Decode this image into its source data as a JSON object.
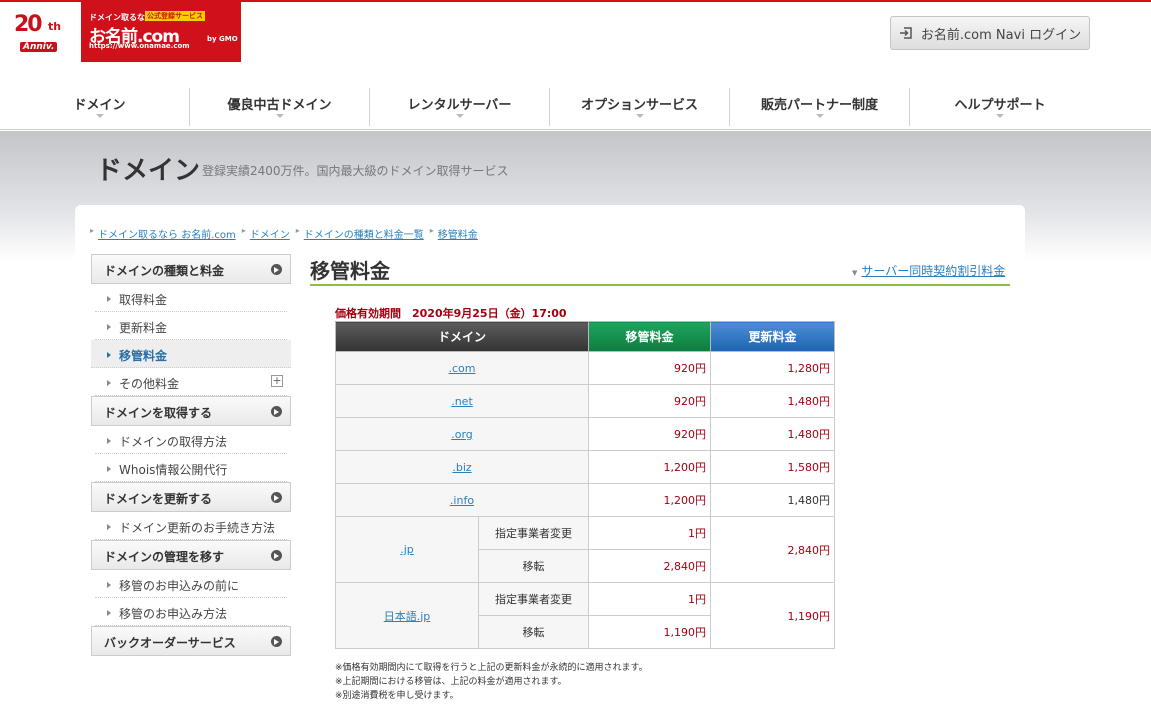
{
  "header": {
    "anniv_number": "20",
    "anniv_suffix": "th",
    "anniv_label": "Anniv.",
    "logo_tagline": "ドメイン取るなら",
    "logo_badge": "公式登録サービス",
    "logo_name": "お名前.com",
    "logo_url": "https://www.onamae.com",
    "logo_gmo": "by GMO",
    "login_label": "お名前.com Navi ログイン"
  },
  "gnav": [
    "ドメイン",
    "優良中古ドメイン",
    "レンタルサーバー",
    "オプションサービス",
    "販売パートナー制度",
    "ヘルプサポート"
  ],
  "band": {
    "title": "ドメイン",
    "desc": "登録実績2400万件。国内最大級のドメイン取得サービス"
  },
  "breadcrumb": [
    "ドメイン取るなら お名前.com",
    "ドメイン",
    "ドメインの種類と料金一覧",
    "移管料金"
  ],
  "sidebar": {
    "sections": [
      {
        "title": "ドメインの種類と料金",
        "items": [
          "取得料金",
          "更新料金",
          "移管料金",
          "その他料金"
        ]
      },
      {
        "title": "ドメインを取得する",
        "items": [
          "ドメインの取得方法",
          "Whois情報公開代行"
        ]
      },
      {
        "title": "ドメインを更新する",
        "items": [
          "ドメイン更新のお手続き方法"
        ]
      },
      {
        "title": "ドメインの管理を移す",
        "items": [
          "移管のお申込みの前に",
          "移管のお申込み方法"
        ]
      },
      {
        "title": "バックオーダーサービス",
        "items": []
      }
    ]
  },
  "main": {
    "title": "移管料金",
    "link": "サーバー同時契約割引料金",
    "period": "価格有効期間　2020年9月25日（金）17:00",
    "table": {
      "headers": [
        "ドメイン",
        "移管料金",
        "更新料金"
      ],
      "rows": [
        {
          "domain": ".com",
          "transfer": "920円",
          "renew": "1,280円"
        },
        {
          "domain": ".net",
          "transfer": "920円",
          "renew": "1,480円"
        },
        {
          "domain": ".org",
          "transfer": "920円",
          "renew": "1,480円"
        },
        {
          "domain": ".biz",
          "transfer": "1,200円",
          "renew": "1,580円"
        },
        {
          "domain": ".info",
          "transfer": "1,200円",
          "renew": "1,480円"
        }
      ],
      "jp": {
        "domain": ".jp",
        "sub1": "指定事業者変更",
        "sub1_price": "1円",
        "sub2": "移転",
        "sub2_price": "2,840円",
        "renew": "2,840円"
      },
      "nihongo": {
        "domain": "日本語.jp",
        "sub1": "指定事業者変更",
        "sub1_price": "1円",
        "sub2": "移転",
        "sub2_price": "1,190円",
        "renew": "1,190円"
      }
    },
    "notes": [
      "※価格有効期間内にて取得を行うと上記の更新料金が永続的に適用されます。",
      "※上記期間における移管は、上記の料金が適用されます。",
      "※別途消費税を申し受けます。"
    ]
  }
}
